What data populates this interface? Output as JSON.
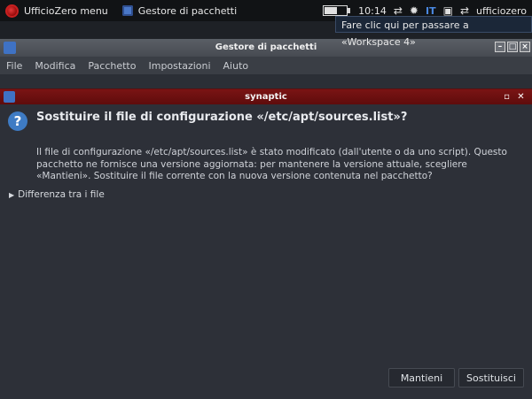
{
  "panel": {
    "menu_label": "UfficioZero menu",
    "task_label": "Gestore di pacchetti",
    "time": "10:14",
    "lang": "IT",
    "user": "ufficiozero",
    "battery_level": 0.6,
    "workspace_tooltip": "Fare clic qui per passare a «Workspace 4»"
  },
  "parent_window": {
    "title": "Gestore di pacchetti",
    "menu": [
      "File",
      "Modifica",
      "Pacchetto",
      "Impostazioni",
      "Aiuto"
    ]
  },
  "dialog": {
    "title": "synaptic",
    "heading": "Sostituire il file di configurazione «/etc/apt/sources.list»?",
    "body": "Il file di configurazione «/etc/apt/sources.list» è stato modificato (dall'utente o da uno script). Questo pacchetto ne fornisce una versione aggiornata: per mantenere la versione attuale, scegliere «Mantieni». Sostituire il file corrente con la nuova versione contenuta nel pacchetto?",
    "expander_label": "Differenza tra i file",
    "keep_label": "Mantieni",
    "replace_label": "Sostituisci"
  },
  "colors": {
    "dialog_titlebar": "#7a1414",
    "accent": "#3e7bc4"
  }
}
